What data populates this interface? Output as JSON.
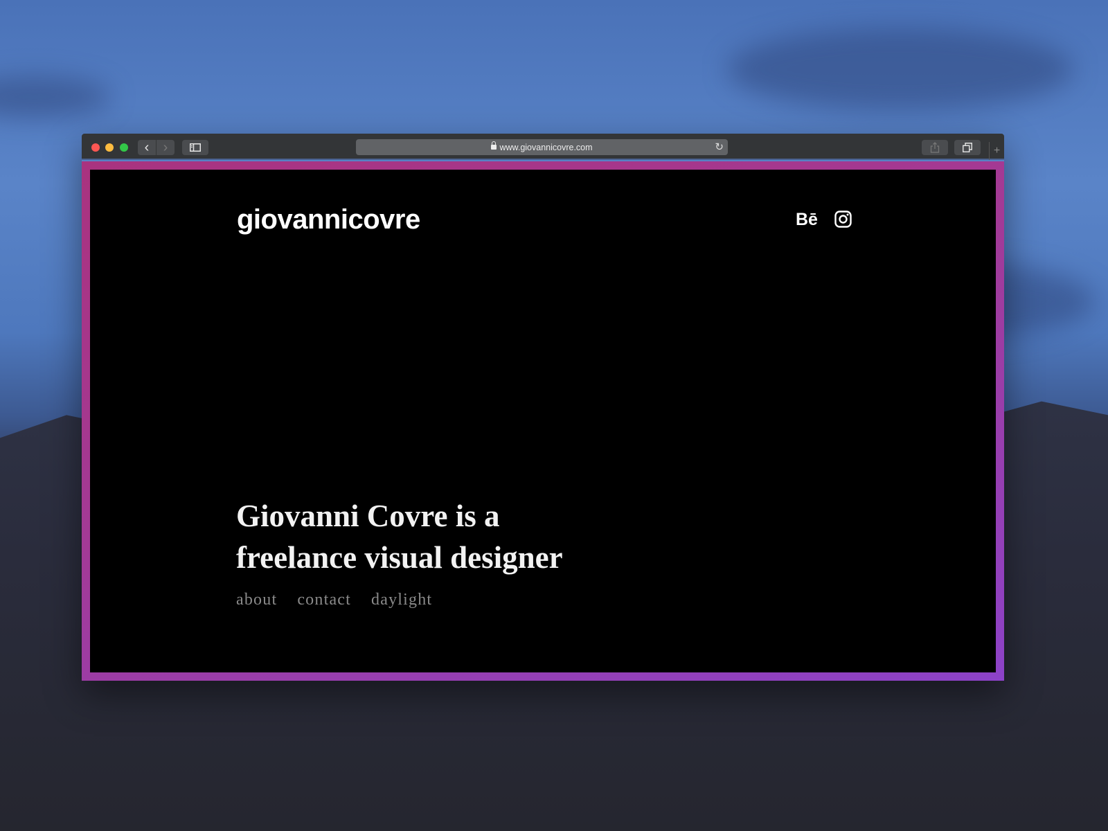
{
  "browser": {
    "url": "www.giovannicovre.com",
    "icons": {
      "close": "close-window-icon",
      "minimize": "minimize-window-icon",
      "zoom": "zoom-window-icon",
      "back": "chevron-left-icon",
      "forward": "chevron-right-icon",
      "sidebar": "sidebar-icon",
      "lock": "lock-icon",
      "reload": "reload-icon",
      "share": "share-icon",
      "tabs": "tabs-overview-icon",
      "new_tab": "plus-icon"
    },
    "glyphs": {
      "back": "‹",
      "forward": "›",
      "reload": "↻",
      "new_tab": "+"
    }
  },
  "site": {
    "logo": "giovannicovre",
    "social": {
      "behance": "Bē",
      "instagram": "instagram"
    },
    "headline_line1": "Giovanni Covre is a",
    "headline_line2": "freelance visual designer",
    "nav": [
      {
        "label": "about"
      },
      {
        "label": "contact"
      },
      {
        "label": "daylight"
      }
    ]
  },
  "colors": {
    "frame_gradient_start": "#a9337f",
    "frame_gradient_end": "#8c42c8",
    "page_background": "#000000",
    "headline_text": "#f2f2f2",
    "nav_text": "#8a8a8a"
  }
}
